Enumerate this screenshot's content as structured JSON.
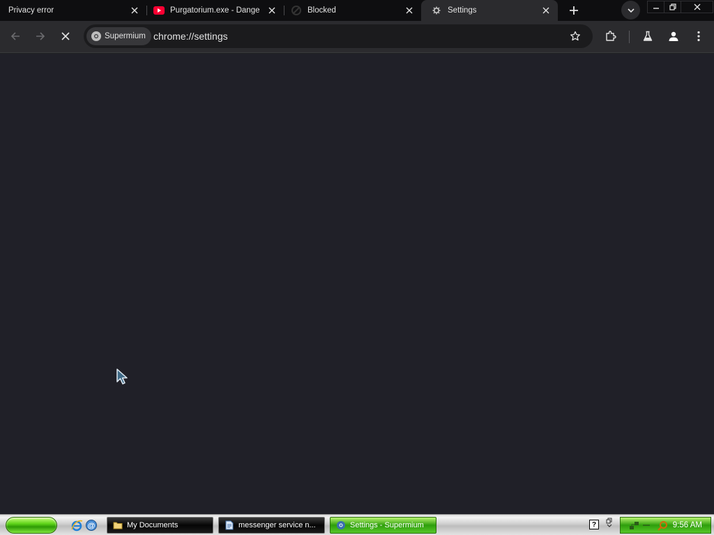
{
  "tabs": [
    {
      "title": "Privacy error",
      "favicon": "none",
      "active": false
    },
    {
      "title": "Purgatorium.exe - Dangerous",
      "favicon": "youtube-icon",
      "active": false
    },
    {
      "title": "Blocked",
      "favicon": "blocked-icon",
      "active": false
    },
    {
      "title": "Settings",
      "favicon": "settings-gear-icon",
      "active": true
    }
  ],
  "omnibox": {
    "site_chip": "Supermium",
    "url": "chrome://settings"
  },
  "taskbar": {
    "tasks": [
      {
        "label": "My Documents",
        "icon": "folder-icon",
        "active": false
      },
      {
        "label": "messenger service n...",
        "icon": "document-icon",
        "active": false
      },
      {
        "label": "Settings - Supermium",
        "icon": "browser-icon",
        "active": true
      }
    ],
    "help_label": "?",
    "clock": "9:56 AM"
  },
  "colors": {
    "page_background": "#202028",
    "toolbar": "#2b2b2e",
    "tab_strip": "#0e0e10",
    "youtube_red": "#ff0033",
    "taskbar_active_green": "#2e9e0c"
  }
}
